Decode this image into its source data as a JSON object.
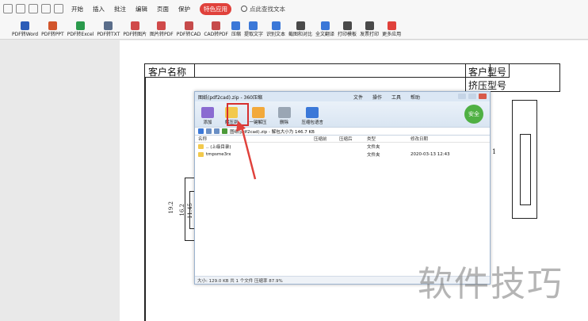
{
  "ribbon_tabs": [
    "开始",
    "插入",
    "批注",
    "编辑",
    "页面",
    "保护",
    "特色应用"
  ],
  "active_tab": "特色应用",
  "search_label": "点此查找文本",
  "tools": [
    "PDF转Word",
    "PDF转PPT",
    "PDF转Excel",
    "PDF转TXT",
    "PDF转图片",
    "图片转PDF",
    "PDF转CAD",
    "CAD转PDF",
    "压缩",
    "提取文字",
    "识别文本",
    "截图和对比",
    "全文翻译",
    "打印模板",
    "发票打印",
    "更多应用"
  ],
  "drawing": {
    "customer_name": "客户名称",
    "customer_model": "客户型号",
    "extrusion_model": "挤压型号",
    "dims": [
      "19.2",
      "16.2",
      "11.45"
    ],
    "side_mark": "1"
  },
  "zip": {
    "title": "图纸(pdf2cad).zip - 360压缩",
    "menu": [
      "文件",
      "操作",
      "工具",
      "帮助"
    ],
    "toolbar": [
      "添加",
      "解压到",
      "一键解压",
      "删除",
      "压缩包语言"
    ],
    "safe_label": "安全",
    "path": "图纸(pdf2cad).zip - 解包大小为 146.7 KB",
    "columns": [
      "名称",
      "压缩前",
      "压缩后",
      "类型",
      "修改日期"
    ],
    "rows": [
      {
        "name": ".. (上级目录)",
        "compressed": "",
        "original": "",
        "type": "文件夹",
        "date": ""
      },
      {
        "name": "tmpsme3rx",
        "compressed": "",
        "original": "",
        "type": "文件夹",
        "date": "2020-03-13 12:43"
      }
    ],
    "status": "大小: 129.0 KB 共 1 个文件 压缩率 87.9%"
  },
  "watermark": "软件技巧"
}
